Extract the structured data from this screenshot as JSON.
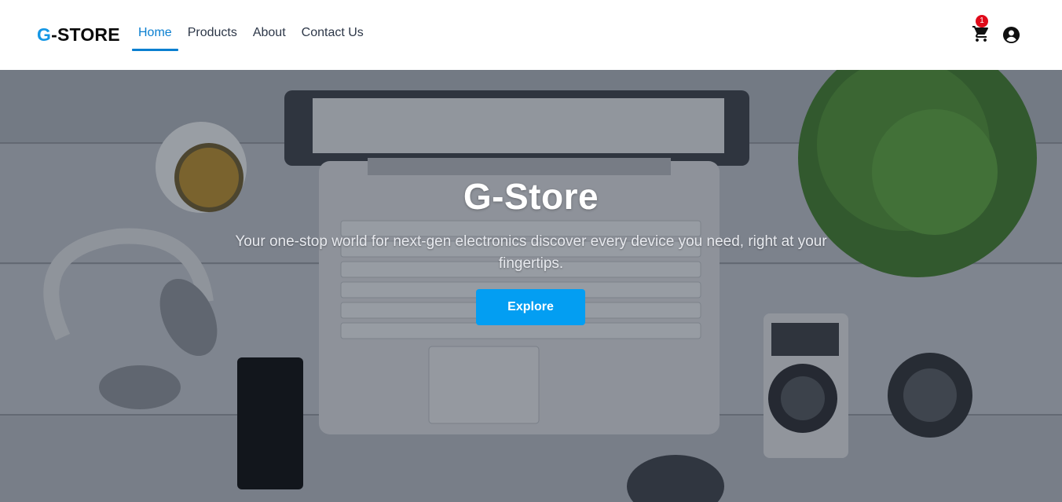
{
  "header": {
    "logo_g": "G",
    "logo_rest": "-STORE",
    "nav": [
      {
        "label": "Home",
        "active": true
      },
      {
        "label": "Products",
        "active": false
      },
      {
        "label": "About",
        "active": false
      },
      {
        "label": "Contact Us",
        "active": false
      }
    ],
    "cart": {
      "icon": "cart-icon",
      "badge_count": "1",
      "badge_color": "#e00a1a"
    },
    "account": {
      "icon": "user-circle-icon"
    }
  },
  "hero": {
    "title": "G-Store",
    "subtitle": "Your one-stop world for next-gen electronics discover every device you need, right at your fingertips.",
    "button_label": "Explore",
    "button_color": "#039ef2"
  },
  "colors": {
    "accent": "#0a7fd0",
    "logo_accent": "#1597e5"
  }
}
